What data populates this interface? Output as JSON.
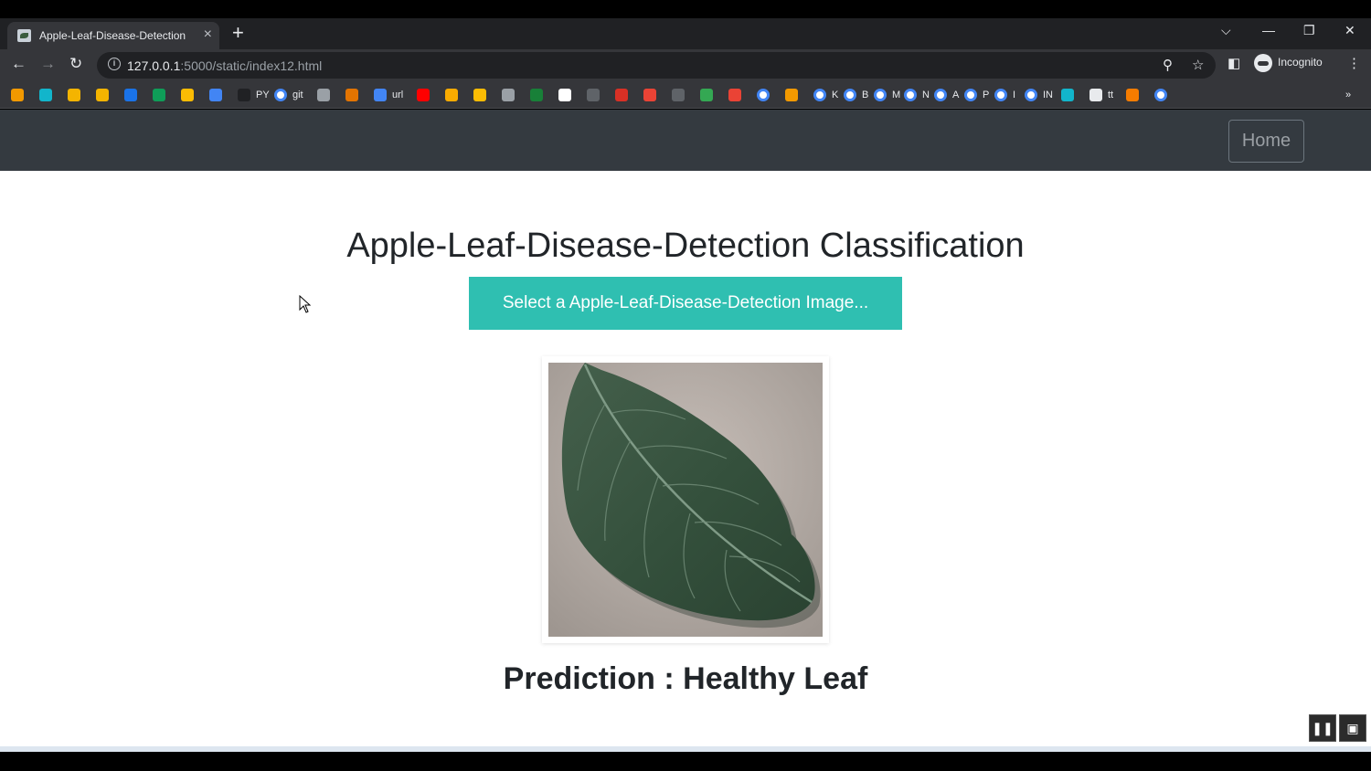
{
  "browser": {
    "tab_title": "Apple-Leaf-Disease-Detection",
    "url_host": "127.0.0.1",
    "url_rest": ":5000/static/index12.html",
    "profile_label": "Incognito",
    "bookmarks": [
      {
        "label": "",
        "color": "#f29900"
      },
      {
        "label": "",
        "color": "#12b5cb"
      },
      {
        "label": "",
        "color": "#f4b400"
      },
      {
        "label": "",
        "color": "#f4b400"
      },
      {
        "label": "",
        "color": "#1a73e8"
      },
      {
        "label": "",
        "color": "#0f9d58"
      },
      {
        "label": "",
        "color": "#fbbc04"
      },
      {
        "label": "",
        "color": "#4285f4"
      },
      {
        "label": "PY",
        "color": "#202124"
      },
      {
        "label": "git",
        "color": "google"
      },
      {
        "label": "",
        "color": "#9aa0a6"
      },
      {
        "label": "",
        "color": "#e37400"
      },
      {
        "label": "url",
        "color": "#4285f4"
      },
      {
        "label": "",
        "color": "#ff0000"
      },
      {
        "label": "",
        "color": "#f9ab00"
      },
      {
        "label": "",
        "color": "#fbbc04"
      },
      {
        "label": "",
        "color": "#9aa0a6"
      },
      {
        "label": "",
        "color": "#188038"
      },
      {
        "label": "",
        "color": "#ffffff"
      },
      {
        "label": "",
        "color": "#5f6368"
      },
      {
        "label": "",
        "color": "#d93025"
      },
      {
        "label": "",
        "color": "#ea4335"
      },
      {
        "label": "",
        "color": "#5f6368"
      },
      {
        "label": "",
        "color": "#34a853"
      },
      {
        "label": "",
        "color": "#ea4335"
      },
      {
        "label": "",
        "color": "google"
      },
      {
        "label": "",
        "color": "#f29900"
      },
      {
        "label": "K",
        "color": "google"
      },
      {
        "label": "B",
        "color": "google"
      },
      {
        "label": "M",
        "color": "google"
      },
      {
        "label": "N",
        "color": "google"
      },
      {
        "label": "A",
        "color": "google"
      },
      {
        "label": "P",
        "color": "google"
      },
      {
        "label": "I",
        "color": "google"
      },
      {
        "label": "IN",
        "color": "google"
      },
      {
        "label": "",
        "color": "#12b5cb"
      },
      {
        "label": "tt",
        "color": "#e8eaed"
      },
      {
        "label": "",
        "color": "#f57c00"
      },
      {
        "label": "",
        "color": "google"
      }
    ]
  },
  "app": {
    "nav_home": "Home",
    "title": "Apple-Leaf-Disease-Detection Classification",
    "select_button": "Select a Apple-Leaf-Disease-Detection Image...",
    "prediction_label": "Prediction : ",
    "prediction_value": "Healthy Leaf"
  }
}
